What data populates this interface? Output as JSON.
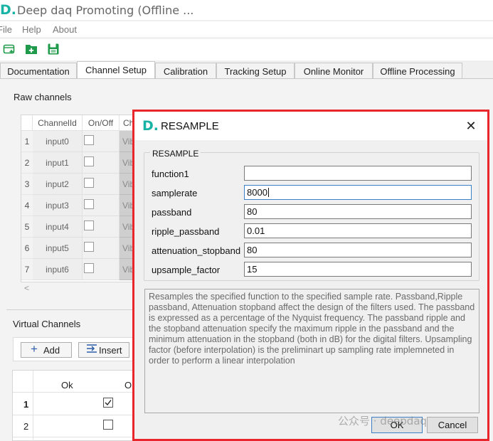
{
  "window": {
    "logo": "D.",
    "title": "Deep daq Promoting (Offline ..."
  },
  "menu": [
    "File",
    "Help",
    "About"
  ],
  "toolbar": {
    "icons": [
      "new-window-icon",
      "add-folder-icon",
      "save-icon"
    ]
  },
  "tabs": [
    {
      "label": "Documentation",
      "active": false
    },
    {
      "label": "Channel Setup",
      "active": true
    },
    {
      "label": "Calibration",
      "active": false
    },
    {
      "label": "Tracking Setup",
      "active": false
    },
    {
      "label": "Online Monitor",
      "active": false
    },
    {
      "label": "Offline Processing",
      "active": false
    }
  ],
  "raw_channels": {
    "label": "Raw channels",
    "columns": [
      "ChannelId",
      "On/Off",
      "Ch"
    ],
    "rows": [
      {
        "num": "1",
        "id": "input0",
        "ch": "Vib"
      },
      {
        "num": "2",
        "id": "input1",
        "ch": "Vib"
      },
      {
        "num": "3",
        "id": "input2",
        "ch": "Vib"
      },
      {
        "num": "4",
        "id": "input3",
        "ch": "Vib"
      },
      {
        "num": "5",
        "id": "input4",
        "ch": "Vib"
      },
      {
        "num": "6",
        "id": "input5",
        "ch": "Vib"
      },
      {
        "num": "7",
        "id": "input6",
        "ch": "Vib"
      }
    ],
    "scroll_arrow": "<"
  },
  "virtual_channels": {
    "label": "Virtual Channels",
    "add_label": "Add",
    "insert_label": "Insert",
    "columns": [
      "Ok",
      "On"
    ],
    "rows": [
      {
        "num": "1",
        "checked": true
      },
      {
        "num": "2",
        "checked": false
      }
    ]
  },
  "dialog": {
    "logo": "D.",
    "title": "RESAMPLE",
    "close": "✕",
    "group_title": "RESAMPLE",
    "params": [
      {
        "label": "function1",
        "value": "",
        "focused": false
      },
      {
        "label": "samplerate",
        "value": "8000",
        "focused": true
      },
      {
        "label": "passband",
        "value": "80",
        "focused": false
      },
      {
        "label": "ripple_passband",
        "value": "0.01",
        "focused": false
      },
      {
        "label": "attenuation_stopband",
        "value": "80",
        "focused": false
      },
      {
        "label": "upsample_factor",
        "value": "15",
        "focused": false
      }
    ],
    "description": "Resamples the specified function to the specified sample rate. Passband,Ripple passband, Attenuation stopband affect the design of the filters used. The passband is expressed as a percentage of the Nyquist frequency. The passband ripple and the stopband attenuation specify the maximum ripple in the passband and the minimum attenuation in the stopband (both in dB) for the digital filters. Upsampling factor (before interpolation) is the preliminart up sampling rate implemneted in order to perform a linear interpolation",
    "ok_label": "OK",
    "cancel_label": "Cancel",
    "highlight_color": "#e8262b"
  },
  "watermark": "公众号 · deepdaq",
  "colors": {
    "brand": "#19b3a6",
    "accent": "#3b7fc4"
  }
}
